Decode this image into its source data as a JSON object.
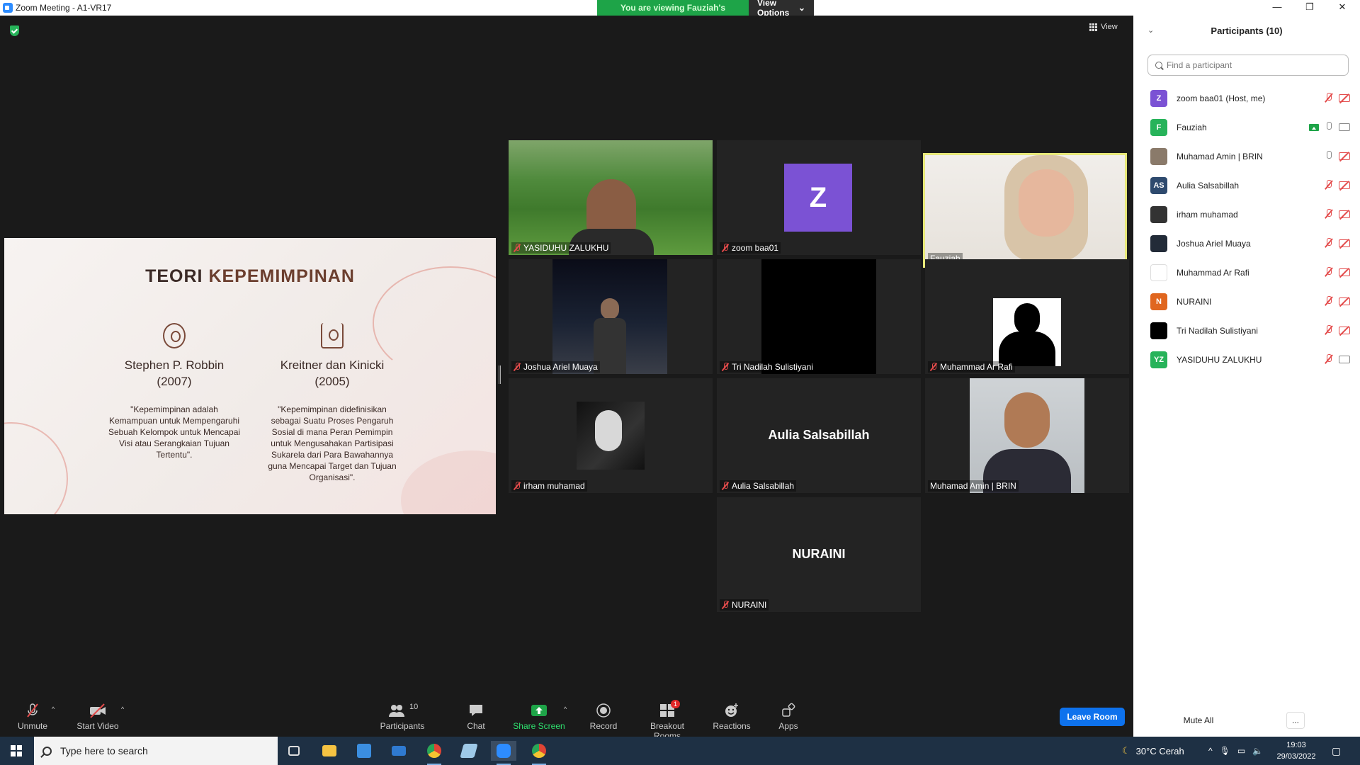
{
  "window": {
    "title": "Zoom Meeting - A1-VR17"
  },
  "banner": {
    "viewing": "You are viewing Fauziah's screen",
    "view_options": "View Options"
  },
  "view_button": "View",
  "slide": {
    "title_part1": "TEORI",
    "title_part2": "KEPEMIMPINAN",
    "left": {
      "name": "Stephen P. Robbin",
      "year": "(2007)",
      "quote": "\"Kepemimpinan adalah Kemampuan untuk Mempengaruhi Sebuah Kelompok untuk Mencapai Visi atau Serangkaian Tujuan Tertentu\"."
    },
    "right": {
      "name": "Kreitner dan Kinicki",
      "year": "(2005)",
      "quote": "\"Kepemimpinan didefinisikan sebagai Suatu Proses Pengaruh Sosial di mana Peran Pemimpin untuk Mengusahakan Partisipasi Sukarela dari Para Bawahannya guna Mencapai Target dan Tujuan Organisasi\"."
    }
  },
  "tiles": [
    {
      "name": "YASIDUHU ZALUKHU"
    },
    {
      "name": "zoom baa01",
      "avatar_letter": "Z"
    },
    {
      "name": "Fauziah"
    },
    {
      "name": "Joshua Ariel Muaya"
    },
    {
      "name": "Tri Nadilah Sulistiyani"
    },
    {
      "name": "Muhammad Ar Rafi"
    },
    {
      "name": "irham muhamad"
    },
    {
      "name": "Aulia Salsabillah",
      "big_name": "Aulia Salsabillah"
    },
    {
      "name": "Muhamad Amin | BRIN"
    },
    {
      "name": "NURAINI",
      "big_name": "NURAINI"
    }
  ],
  "toolbar": {
    "unmute": "Unmute",
    "start_video": "Start Video",
    "participants": "Participants",
    "participants_count": "10",
    "chat": "Chat",
    "share_screen": "Share Screen",
    "record": "Record",
    "breakout_rooms": "Breakout Rooms",
    "breakout_badge": "1",
    "reactions": "Reactions",
    "apps": "Apps",
    "leave": "Leave Room"
  },
  "panel": {
    "title": "Participants (10)",
    "search_placeholder": "Find a participant",
    "mute_all": "Mute All",
    "more": "...",
    "participants": [
      {
        "initials": "Z",
        "name": "zoom baa01 (Host, me)",
        "color": "#7b52d4"
      },
      {
        "initials": "F",
        "name": "Fauziah",
        "color": "#27b35a"
      },
      {
        "initials": "",
        "name": "Muhamad Amin | BRIN",
        "color": "#8a7a6a"
      },
      {
        "initials": "AS",
        "name": "Aulia Salsabillah",
        "color": "#2e4a6e"
      },
      {
        "initials": "",
        "name": "irham muhamad",
        "color": "#333333"
      },
      {
        "initials": "",
        "name": "Joshua Ariel Muaya",
        "color": "#222b38"
      },
      {
        "initials": "",
        "name": "Muhammad Ar Rafi",
        "color": "#ffffff"
      },
      {
        "initials": "N",
        "name": "NURAINI",
        "color": "#e0661f"
      },
      {
        "initials": "",
        "name": "Tri Nadilah Sulistiyani",
        "color": "#000000"
      },
      {
        "initials": "YZ",
        "name": "YASIDUHU ZALUKHU",
        "color": "#27b35a"
      }
    ]
  },
  "taskbar": {
    "search_placeholder": "Type here to search",
    "weather": "30°C  Cerah",
    "time": "19:03",
    "date": "29/03/2022"
  }
}
